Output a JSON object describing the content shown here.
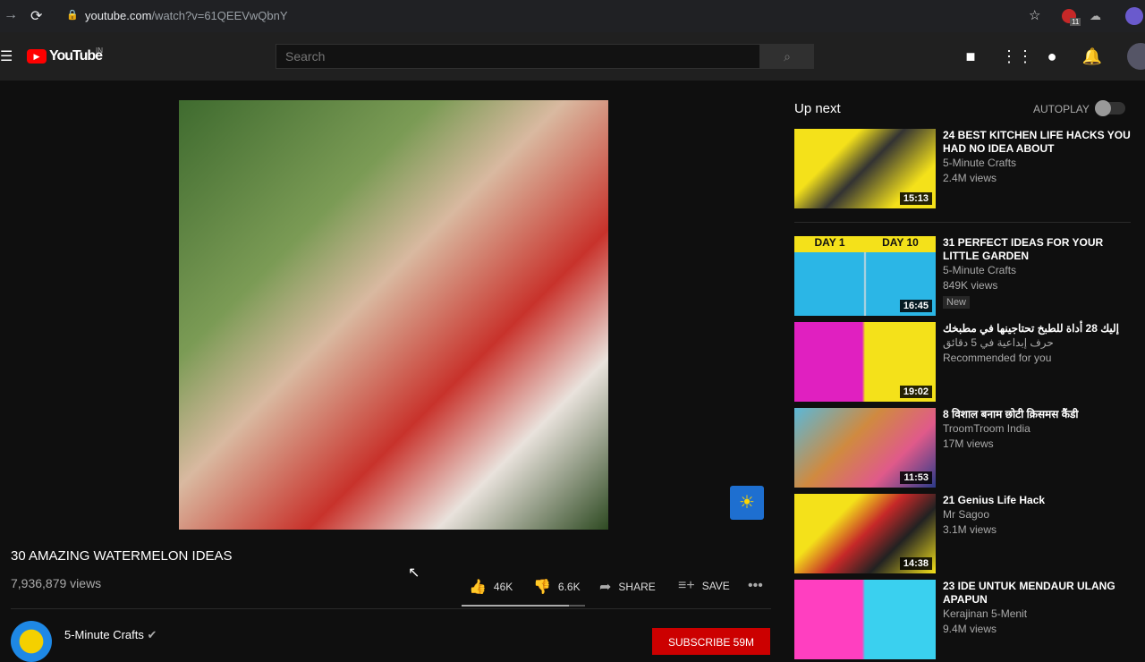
{
  "browser": {
    "url_domain": "youtube.com",
    "url_path": "/watch?v=61QEEVwQbnY",
    "ext_badge": "11"
  },
  "header": {
    "logo": "YouTube",
    "region": "IN",
    "search_placeholder": "Search"
  },
  "video": {
    "title": "30 AMAZING WATERMELON IDEAS",
    "views": "7,936,879 views",
    "likes": "46K",
    "dislikes": "6.6K",
    "share": "SHARE",
    "save": "SAVE",
    "like_ratio": 0.87
  },
  "channel": {
    "name": "5-Minute Crafts",
    "subscribe": "SUBSCRIBE 59M"
  },
  "sidebar": {
    "up_next": "Up next",
    "autoplay": "AUTOPLAY",
    "autoplay_on": false,
    "items": [
      {
        "title": "24 BEST KITCHEN LIFE HACKS YOU HAD NO IDEA ABOUT",
        "channel": "5-Minute Crafts",
        "views": "2.4M views",
        "duration": "15:13"
      },
      {
        "title": "31 PERFECT IDEAS FOR YOUR LITTLE GARDEN",
        "channel": "5-Minute Crafts",
        "views": "849K views",
        "badge": "New",
        "duration": "16:45",
        "thumb_left": "DAY 1",
        "thumb_right": "DAY 10"
      },
      {
        "title": "إليك 28 أداة للطبخ تحتاجينها في مطبخك",
        "channel": "حرف إبداعية في 5 دقائق",
        "views": "Recommended for you",
        "duration": "19:02"
      },
      {
        "title": "8 विशाल बनाम छोटी क्रिसमस कैंडी",
        "channel": "TroomTroom India",
        "views": "17M views",
        "duration": "11:53"
      },
      {
        "title": "21 Genius Life Hack",
        "channel": "Mr Sagoo",
        "views": "3.1M views",
        "duration": "14:38"
      },
      {
        "title": "23 IDE UNTUK MENDAUR ULANG APAPUN",
        "channel": "Kerajinan 5-Menit",
        "views": "9.4M views"
      }
    ]
  }
}
